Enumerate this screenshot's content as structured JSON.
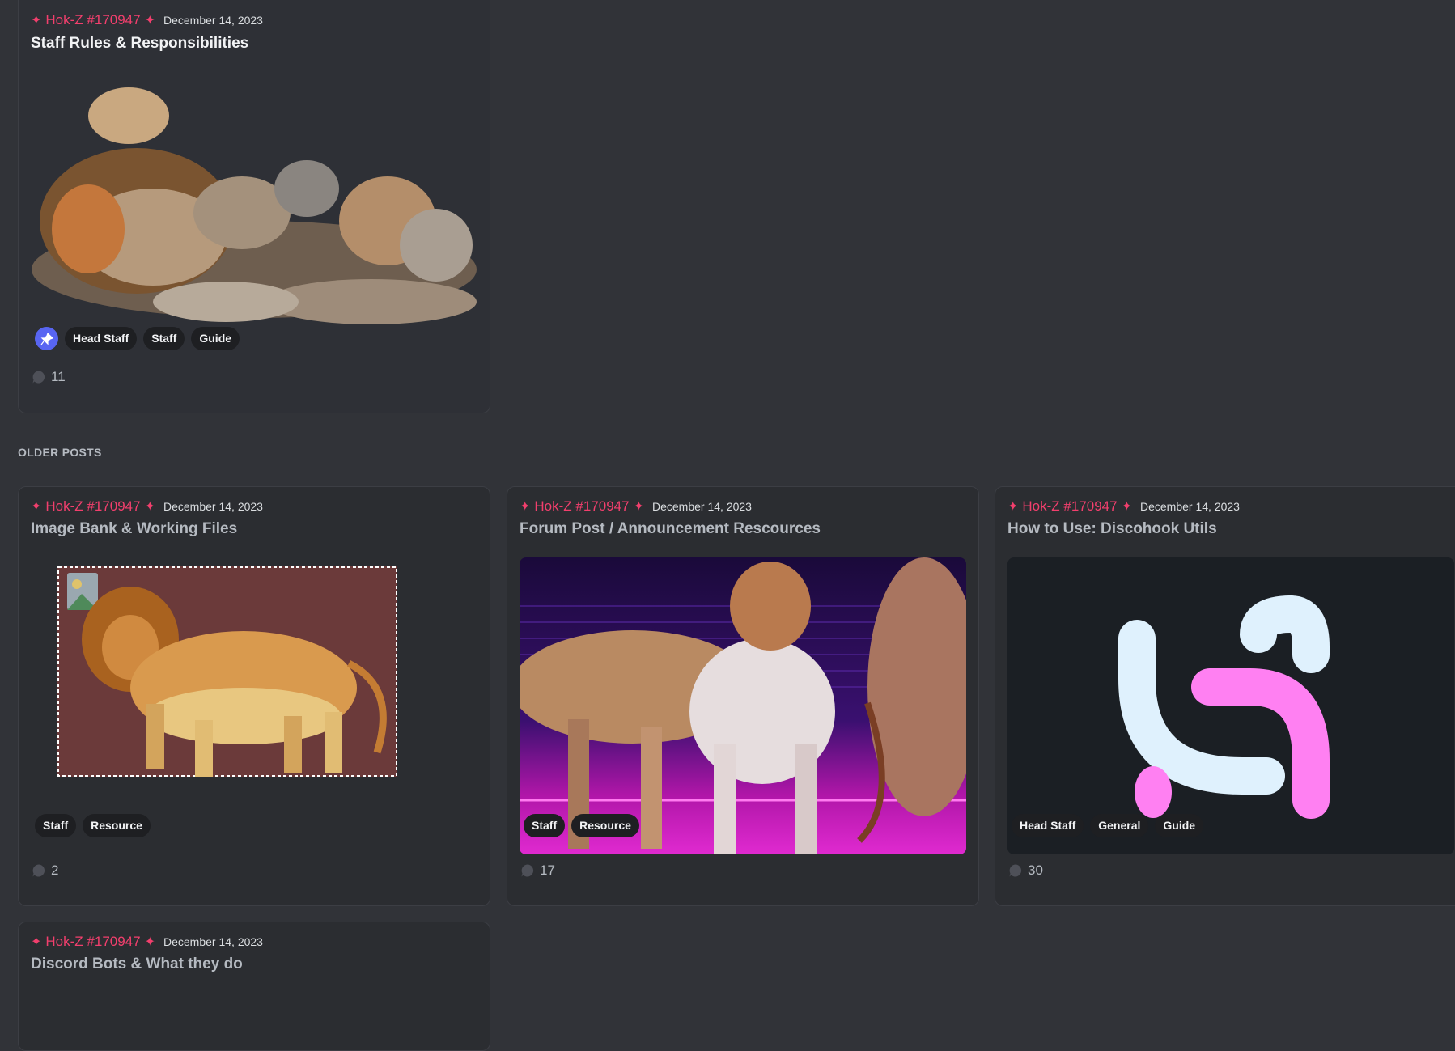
{
  "section_label": "OLDER POSTS",
  "colors": {
    "background": "#313338",
    "card": "#2b2d31",
    "author": "#f23f6d",
    "tag_bg": "#1e1f22",
    "pin": "#5865f2"
  },
  "featured": {
    "author": "Hok-Z #170947",
    "date": "December 14, 2023",
    "title": "Staff Rules & Responsibilities",
    "image_desc": "lion-pride-illustration",
    "pinned_icon": "pin-icon",
    "tags": [
      "Head Staff",
      "Staff",
      "Guide"
    ],
    "reply_count": "11"
  },
  "posts": [
    {
      "author": "Hok-Z #170947",
      "date": "December 14, 2023",
      "title": "Image Bank & Working Files",
      "tags": [
        "Staff",
        "Resource"
      ],
      "reply_count": "2"
    },
    {
      "author": "Hok-Z #170947",
      "date": "December 14, 2023",
      "title": "Forum Post / Announcement Rescources",
      "tags": [
        "Staff",
        "Resource"
      ],
      "reply_count": "17"
    },
    {
      "author": "Hok-Z #170947",
      "date": "December 14, 2023",
      "title": "How to Use: Discohook Utils",
      "tags": [
        "Head Staff",
        "General",
        "Guide"
      ],
      "reply_count": "30"
    },
    {
      "author": "Hok-Z #170947",
      "date": "December 14, 2023",
      "title": "Discord Bots & What they do"
    }
  ]
}
